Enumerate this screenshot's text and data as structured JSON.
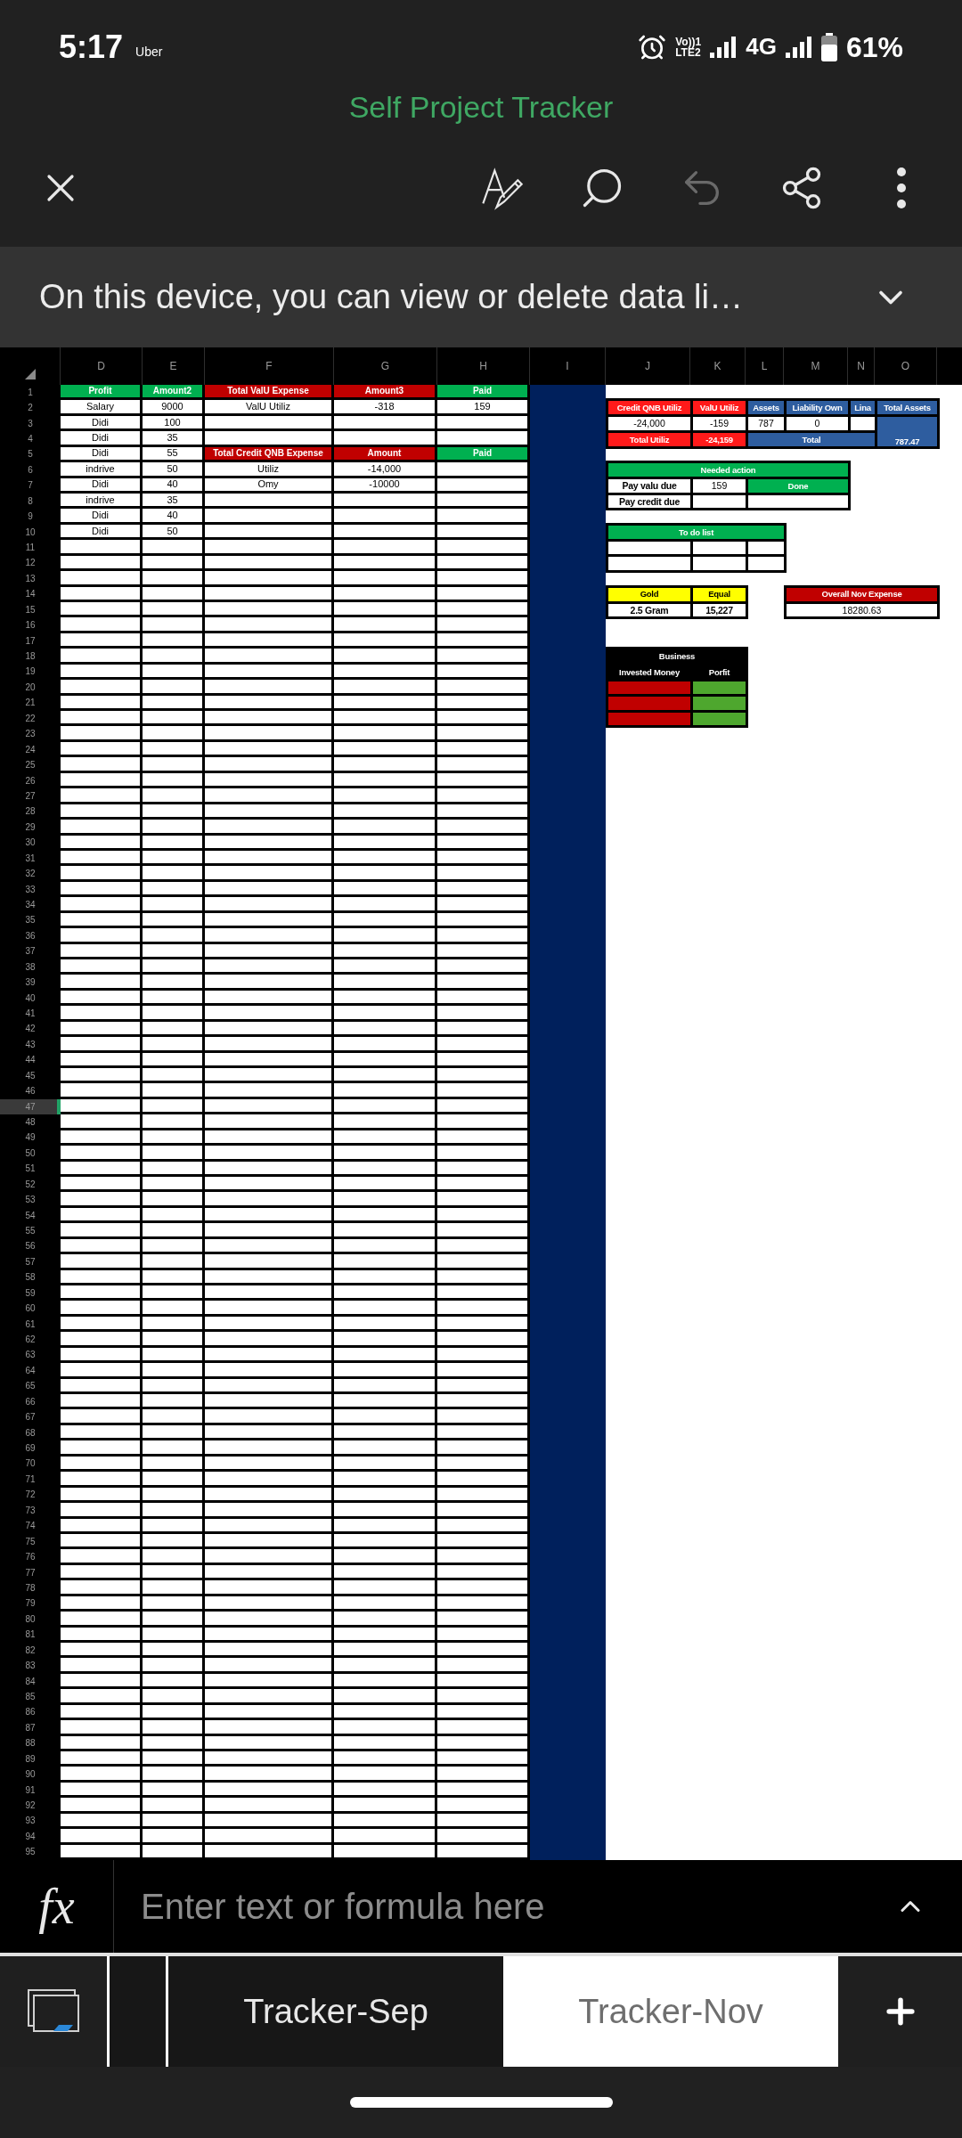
{
  "status_bar": {
    "time": "5:17",
    "carrier": "Uber",
    "volte": [
      "Vo))1",
      "LTE2"
    ],
    "network": "4G",
    "battery": "61%"
  },
  "title": "Self Project Tracker",
  "toolbar": [
    {
      "kind": "close",
      "disabled": false
    },
    {
      "kind": "draw",
      "disabled": false
    },
    {
      "kind": "search",
      "disabled": false
    },
    {
      "kind": "undo",
      "disabled": true
    },
    {
      "kind": "share",
      "disabled": false
    },
    {
      "kind": "more",
      "disabled": false
    }
  ],
  "notice": {
    "text": "On this device, you can view or delete data li…"
  },
  "sheet": {
    "columns": [
      "D",
      "E",
      "F",
      "G",
      "H",
      "I",
      "J",
      "K",
      "L",
      "M",
      "N",
      "O"
    ],
    "rows": [
      {
        "number": "1",
        "selected": false,
        "cells": [
          {
            "text": "Profit",
            "color": "#00b050"
          },
          {
            "text": "Amount2",
            "color": "#00b050"
          },
          {
            "text": "Total ValU Expense",
            "color": "#c00000"
          },
          {
            "text": "Amount3",
            "color": "#c00000"
          },
          {
            "text": "Paid",
            "color": "#00b050"
          }
        ]
      },
      {
        "number": "2",
        "selected": false,
        "cells": [
          "Salary",
          "9000",
          "ValU Utiliz",
          "-318",
          "159"
        ]
      },
      {
        "number": "3",
        "selected": false,
        "cells": [
          "Didi",
          "100",
          null,
          null,
          null
        ]
      },
      {
        "number": "4",
        "selected": false,
        "cells": [
          "Didi",
          "35",
          null,
          null,
          null
        ]
      },
      {
        "number": "5",
        "selected": false,
        "cells": [
          "Didi",
          "55",
          {
            "text": "Total Credit QNB Expense",
            "color": "#c00000"
          },
          {
            "text": "Amount",
            "color": "#c00000"
          },
          {
            "text": "Paid",
            "color": "#00b050"
          }
        ]
      },
      {
        "number": "6",
        "selected": false,
        "cells": [
          "indrive",
          "50",
          "Utiliz",
          "-14,000",
          null
        ]
      },
      {
        "number": "7",
        "selected": false,
        "cells": [
          "Didi",
          "40",
          "Omy",
          "-10000",
          null
        ]
      },
      {
        "number": "8",
        "selected": false,
        "cells": [
          "indrive",
          "35",
          null,
          null,
          null
        ]
      },
      {
        "number": "9",
        "selected": false,
        "cells": [
          "Didi",
          "40",
          null,
          null,
          null
        ]
      },
      {
        "number": "10",
        "selected": false,
        "cells": [
          "Didi",
          "50",
          null,
          null,
          null
        ]
      },
      {
        "number": "11",
        "selected": false,
        "cells": []
      },
      {
        "number": "12",
        "selected": false,
        "cells": []
      },
      {
        "number": "13",
        "selected": false,
        "cells": []
      },
      {
        "number": "14",
        "selected": false,
        "cells": []
      },
      {
        "number": "15",
        "selected": false,
        "cells": []
      },
      {
        "number": "16",
        "selected": false,
        "cells": []
      },
      {
        "number": "17",
        "selected": false,
        "cells": []
      },
      {
        "number": "18",
        "selected": false,
        "cells": []
      },
      {
        "number": "19",
        "selected": false,
        "cells": []
      },
      {
        "number": "20",
        "selected": false,
        "cells": []
      },
      {
        "number": "21",
        "selected": false,
        "cells": []
      },
      {
        "number": "22",
        "selected": false,
        "cells": []
      },
      {
        "number": "23",
        "selected": false,
        "cells": []
      },
      {
        "number": "24",
        "selected": false,
        "cells": []
      },
      {
        "number": "25",
        "selected": false,
        "cells": []
      },
      {
        "number": "26",
        "selected": false,
        "cells": []
      },
      {
        "number": "27",
        "selected": false,
        "cells": []
      },
      {
        "number": "28",
        "selected": false,
        "cells": []
      },
      {
        "number": "29",
        "selected": false,
        "cells": []
      },
      {
        "number": "30",
        "selected": false,
        "cells": []
      },
      {
        "number": "31",
        "selected": false,
        "cells": []
      },
      {
        "number": "32",
        "selected": false,
        "cells": []
      },
      {
        "number": "33",
        "selected": false,
        "cells": []
      },
      {
        "number": "34",
        "selected": false,
        "cells": []
      },
      {
        "number": "35",
        "selected": false,
        "cells": []
      },
      {
        "number": "36",
        "selected": false,
        "cells": []
      },
      {
        "number": "37",
        "selected": false,
        "cells": []
      },
      {
        "number": "38",
        "selected": false,
        "cells": []
      },
      {
        "number": "39",
        "selected": false,
        "cells": []
      },
      {
        "number": "40",
        "selected": false,
        "cells": []
      },
      {
        "number": "41",
        "selected": false,
        "cells": []
      },
      {
        "number": "42",
        "selected": false,
        "cells": []
      },
      {
        "number": "43",
        "selected": false,
        "cells": []
      },
      {
        "number": "44",
        "selected": false,
        "cells": []
      },
      {
        "number": "45",
        "selected": false,
        "cells": []
      },
      {
        "number": "46",
        "selected": false,
        "cells": []
      },
      {
        "number": "47",
        "selected": true,
        "cells": []
      },
      {
        "number": "48",
        "selected": false,
        "cells": []
      },
      {
        "number": "49",
        "selected": false,
        "cells": []
      },
      {
        "number": "50",
        "selected": false,
        "cells": []
      },
      {
        "number": "51",
        "selected": false,
        "cells": []
      },
      {
        "number": "52",
        "selected": false,
        "cells": []
      },
      {
        "number": "53",
        "selected": false,
        "cells": []
      },
      {
        "number": "54",
        "selected": false,
        "cells": []
      },
      {
        "number": "55",
        "selected": false,
        "cells": []
      },
      {
        "number": "56",
        "selected": false,
        "cells": []
      },
      {
        "number": "57",
        "selected": false,
        "cells": []
      },
      {
        "number": "58",
        "selected": false,
        "cells": []
      },
      {
        "number": "59",
        "selected": false,
        "cells": []
      },
      {
        "number": "60",
        "selected": false,
        "cells": []
      },
      {
        "number": "61",
        "selected": false,
        "cells": []
      },
      {
        "number": "62",
        "selected": false,
        "cells": []
      },
      {
        "number": "63",
        "selected": false,
        "cells": []
      },
      {
        "number": "64",
        "selected": false,
        "cells": []
      },
      {
        "number": "65",
        "selected": false,
        "cells": []
      },
      {
        "number": "66",
        "selected": false,
        "cells": []
      },
      {
        "number": "67",
        "selected": false,
        "cells": []
      },
      {
        "number": "68",
        "selected": false,
        "cells": []
      },
      {
        "number": "69",
        "selected": false,
        "cells": []
      },
      {
        "number": "70",
        "selected": false,
        "cells": []
      },
      {
        "number": "71",
        "selected": false,
        "cells": []
      },
      {
        "number": "72",
        "selected": false,
        "cells": []
      },
      {
        "number": "73",
        "selected": false,
        "cells": []
      },
      {
        "number": "74",
        "selected": false,
        "cells": []
      },
      {
        "number": "75",
        "selected": false,
        "cells": []
      },
      {
        "number": "76",
        "selected": false,
        "cells": []
      },
      {
        "number": "77",
        "selected": false,
        "cells": []
      },
      {
        "number": "78",
        "selected": false,
        "cells": []
      },
      {
        "number": "79",
        "selected": false,
        "cells": []
      },
      {
        "number": "80",
        "selected": false,
        "cells": []
      },
      {
        "number": "81",
        "selected": false,
        "cells": []
      },
      {
        "number": "82",
        "selected": false,
        "cells": []
      },
      {
        "number": "83",
        "selected": false,
        "cells": []
      },
      {
        "number": "84",
        "selected": false,
        "cells": []
      },
      {
        "number": "85",
        "selected": false,
        "cells": []
      },
      {
        "number": "86",
        "selected": false,
        "cells": []
      },
      {
        "number": "87",
        "selected": false,
        "cells": []
      },
      {
        "number": "88",
        "selected": false,
        "cells": []
      },
      {
        "number": "89",
        "selected": false,
        "cells": []
      },
      {
        "number": "90",
        "selected": false,
        "cells": []
      },
      {
        "number": "91",
        "selected": false,
        "cells": []
      },
      {
        "number": "92",
        "selected": false,
        "cells": []
      },
      {
        "number": "93",
        "selected": false,
        "cells": []
      },
      {
        "number": "94",
        "selected": false,
        "cells": []
      },
      {
        "number": "95",
        "selected": false,
        "cells": []
      }
    ],
    "panels": [
      {
        "rows": [
          [
            {
              "text": "Credit QNB Utiliz",
              "kind": "header",
              "color": "#ff1a1a"
            },
            {
              "text": "ValU Utiliz",
              "kind": "header",
              "color": "#ff1a1a"
            },
            {
              "text": "Assets",
              "kind": "header",
              "color": "#2e5d9f"
            },
            {
              "text": "Liability Own",
              "kind": "header",
              "color": "#2e5d9f"
            },
            {
              "text": "Lina",
              "kind": "header",
              "color": "#2e5d9f"
            },
            {
              "text": "Total Assets",
              "kind": "header",
              "color": "#2e5d9f"
            }
          ],
          [
            {
              "text": "-24,000",
              "kind": "value"
            },
            {
              "text": "-159",
              "kind": "value"
            },
            {
              "text": "787",
              "kind": "value"
            },
            {
              "text": "0",
              "kind": "value"
            },
            {
              "kind": "value"
            },
            {
              "text": "787.47",
              "kind": "header",
              "color": "#2e5d9f",
              "rowspan": 2
            }
          ],
          [
            {
              "text": "Total Utiliz",
              "kind": "header",
              "color": "#ff1a1a"
            },
            {
              "text": "-24,159",
              "kind": "header",
              "color": "#ff1a1a"
            },
            {
              "text": "Total",
              "kind": "header",
              "color": "#2e5d9f",
              "colspan": 3
            }
          ]
        ]
      },
      {
        "rows": [
          [
            {
              "text": "Needed action",
              "kind": "header",
              "color": "#00b050",
              "colspan": 4
            }
          ],
          [
            {
              "text": "Pay valu due",
              "kind": "label"
            },
            {
              "text": "159",
              "kind": "value"
            },
            {
              "text": "Done",
              "kind": "header",
              "color": "#00b050",
              "colspan": 2
            }
          ],
          [
            {
              "text": "Pay credit due",
              "kind": "label"
            },
            {
              "kind": "value"
            },
            {
              "kind": "value",
              "colspan": 2
            }
          ]
        ]
      },
      {
        "rows": [
          [
            {
              "text": "To do list",
              "kind": "header",
              "color": "#00b050",
              "colspan": 3
            }
          ],
          [
            {
              "kind": "value"
            },
            {
              "kind": "value"
            },
            {
              "kind": "value"
            }
          ],
          [
            {
              "kind": "value"
            },
            {
              "kind": "value"
            },
            {
              "kind": "value"
            }
          ]
        ]
      },
      {
        "rows": [
          [
            {
              "text": "Gold",
              "kind": "header",
              "color": "#ffff00"
            },
            {
              "text": "Equal",
              "kind": "header",
              "color": "#ffff00"
            }
          ],
          [
            {
              "text": "2.5 Gram",
              "kind": "label"
            },
            {
              "text": "15,227",
              "kind": "label"
            }
          ]
        ]
      },
      {
        "rows": [
          [
            {
              "text": "Overall Nov Expense",
              "kind": "header",
              "color": "#c00000",
              "colspan": 3
            }
          ],
          [
            {
              "text": "18280.63",
              "kind": "value",
              "colspan": 3
            }
          ]
        ]
      },
      {
        "rows": [
          [
            {
              "text": "Business",
              "kind": "header",
              "color": "#000000",
              "colspan": 2
            }
          ],
          [
            {
              "text": "Invested Money",
              "kind": "header",
              "color": "#000000"
            },
            {
              "text": "Porfit",
              "kind": "header",
              "color": "#000000"
            }
          ],
          [
            {
              "kind": "fill",
              "color": "#c00000"
            },
            {
              "kind": "fill",
              "color": "#4ea72e"
            }
          ],
          [
            {
              "kind": "fill",
              "color": "#c00000"
            },
            {
              "kind": "fill",
              "color": "#4ea72e"
            }
          ],
          [
            {
              "kind": "fill",
              "color": "#c00000"
            },
            {
              "kind": "fill",
              "color": "#4ea72e"
            }
          ]
        ]
      }
    ]
  },
  "formula_bar": {
    "label": "fx",
    "placeholder": "Enter text or formula here"
  },
  "sheet_tabs": [
    {
      "label": "Tracker-Sep",
      "selected": false
    },
    {
      "label": "Tracker-Nov",
      "selected": true
    }
  ]
}
